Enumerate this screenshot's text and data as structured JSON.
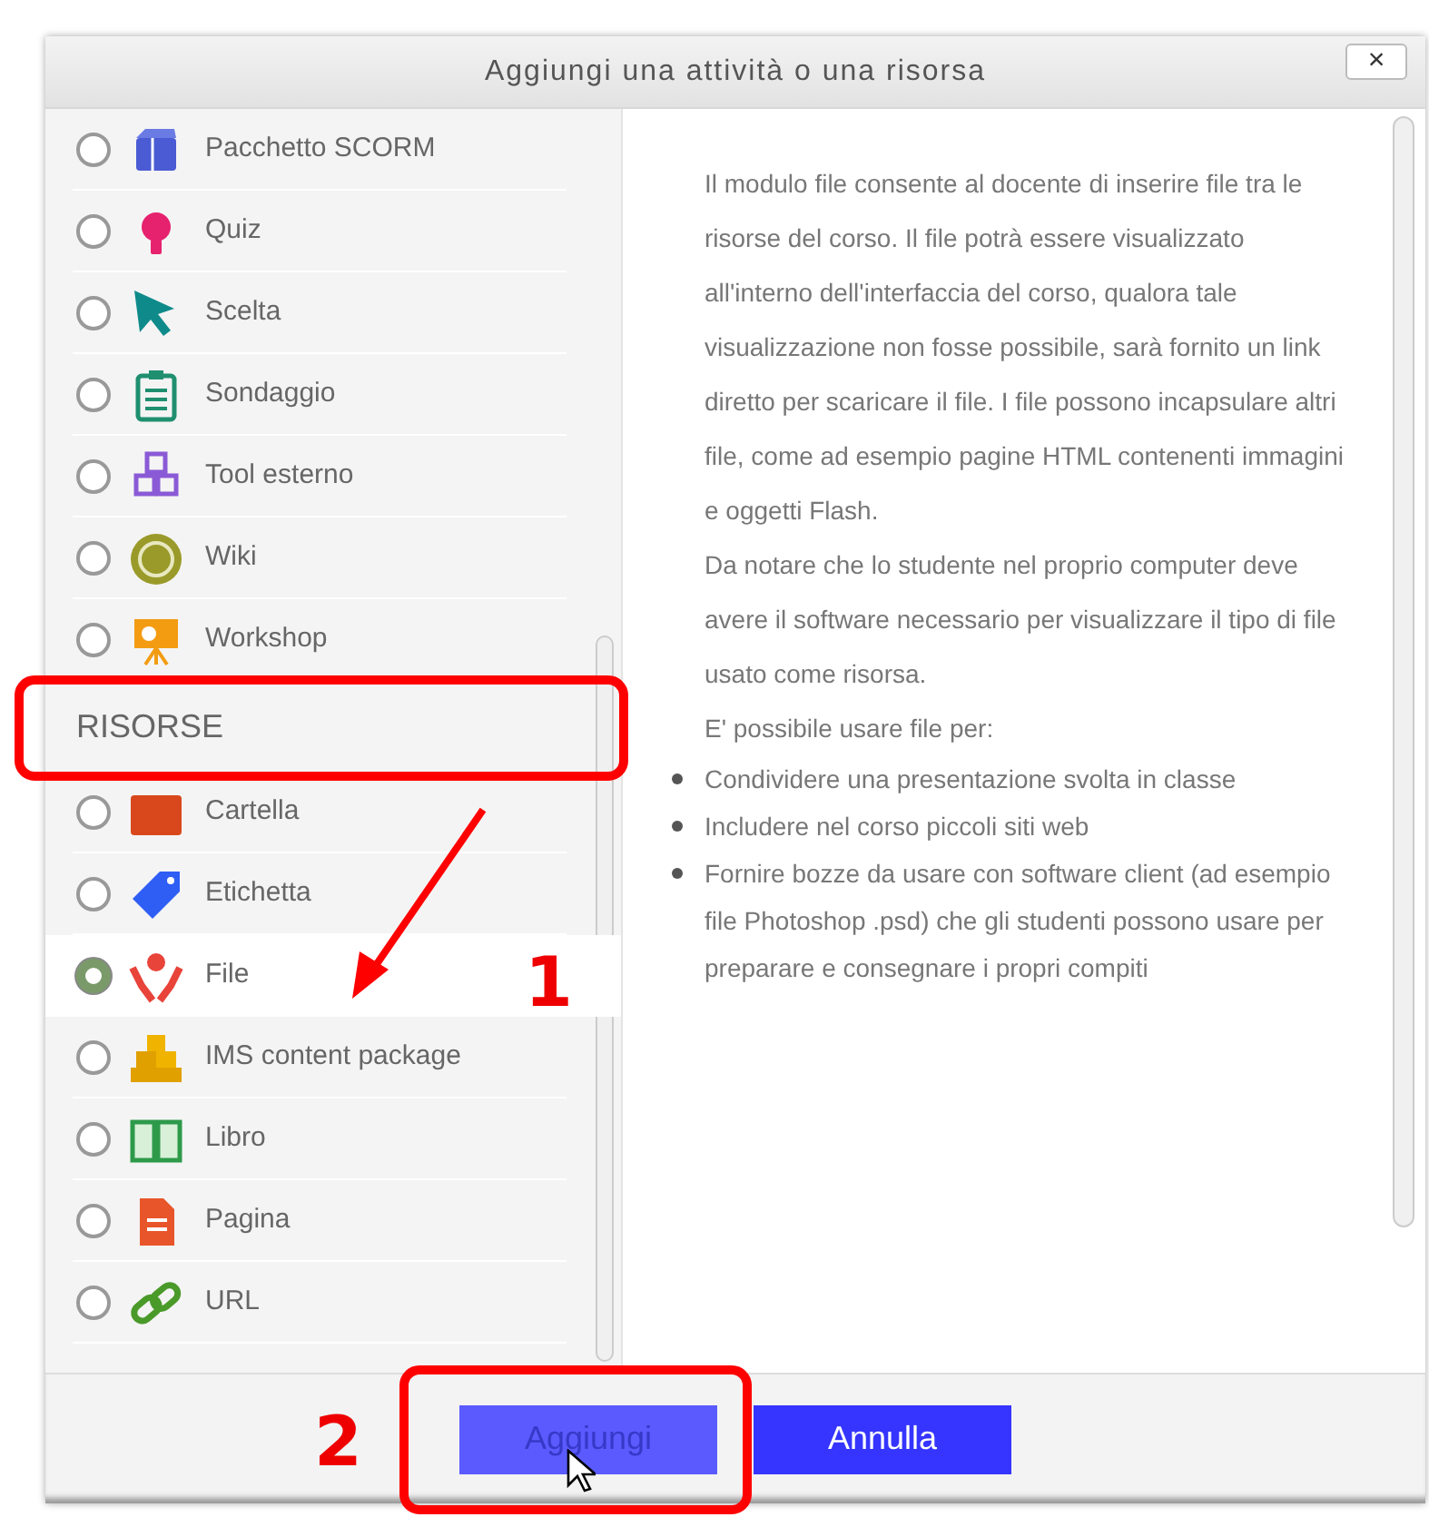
{
  "dialog": {
    "title": "Aggiungi una attività o una risorsa",
    "close": "×",
    "sections": [
      {
        "items": [
          {
            "label": "Pacchetto SCORM",
            "selected": false
          },
          {
            "label": "Quiz",
            "selected": false
          },
          {
            "label": "Scelta",
            "selected": false
          },
          {
            "label": "Sondaggio",
            "selected": false
          },
          {
            "label": "Tool esterno",
            "selected": false
          },
          {
            "label": "Wiki",
            "selected": false
          },
          {
            "label": "Workshop",
            "selected": false
          }
        ]
      },
      {
        "heading": "RISORSE",
        "items": [
          {
            "label": "Cartella",
            "selected": false
          },
          {
            "label": "Etichetta",
            "selected": false
          },
          {
            "label": "File",
            "selected": true
          },
          {
            "label": "IMS content package",
            "selected": false
          },
          {
            "label": "Libro",
            "selected": false
          },
          {
            "label": "Pagina",
            "selected": false
          },
          {
            "label": "URL",
            "selected": false
          }
        ]
      }
    ],
    "description": {
      "paragraphs": [
        "Il modulo file consente al docente di inserire file tra le risorse del corso. Il file potrà essere visualizzato all'interno dell'interfaccia del corso, qualora tale visualizzazione non fosse possibile, sarà fornito un link diretto per scaricare il file. I file possono incapsulare altri file, come ad esempio pagine HTML contenenti immagini e oggetti Flash.",
        "Da notare che lo studente nel proprio computer deve avere il software necessario per visualizzare il tipo di file usato come risorsa.",
        "E' possibile usare file per:"
      ],
      "bullets": [
        "Condividere una presentazione svolta in classe",
        "Includere nel corso piccoli siti web",
        "Fornire bozze da usare con software client (ad esempio file Photoshop .psd) che gli studenti possono usare per preparare e consegnare i propri compiti"
      ]
    },
    "buttons": [
      {
        "label": "Aggiungi",
        "disabled": true
      },
      {
        "label": "Annulla",
        "disabled": false
      }
    ]
  },
  "annotations": [
    {
      "label": "1"
    },
    {
      "label": "2"
    }
  ]
}
